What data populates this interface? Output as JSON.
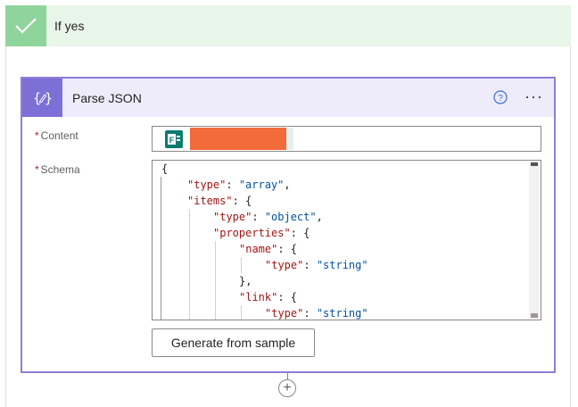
{
  "condition_branch": {
    "label": "If yes"
  },
  "action_card": {
    "title": "Parse JSON",
    "more_label": "···"
  },
  "content_field": {
    "label": "Content",
    "required_mark": "*"
  },
  "schema_field": {
    "label": "Schema",
    "required_mark": "*",
    "code_lines": [
      {
        "indent": 0,
        "parts": [
          [
            "p",
            "{"
          ]
        ]
      },
      {
        "indent": 1,
        "parts": [
          [
            "k",
            "\"type\""
          ],
          [
            "p",
            ": "
          ],
          [
            "s",
            "\"array\""
          ],
          [
            "p",
            ","
          ]
        ]
      },
      {
        "indent": 1,
        "parts": [
          [
            "k",
            "\"items\""
          ],
          [
            "p",
            ": {"
          ]
        ]
      },
      {
        "indent": 2,
        "parts": [
          [
            "k",
            "\"type\""
          ],
          [
            "p",
            ": "
          ],
          [
            "s",
            "\"object\""
          ],
          [
            "p",
            ","
          ]
        ]
      },
      {
        "indent": 2,
        "parts": [
          [
            "k",
            "\"properties\""
          ],
          [
            "p",
            ": {"
          ]
        ]
      },
      {
        "indent": 3,
        "parts": [
          [
            "k",
            "\"name\""
          ],
          [
            "p",
            ": {"
          ]
        ]
      },
      {
        "indent": 4,
        "parts": [
          [
            "k",
            "\"type\""
          ],
          [
            "p",
            ": "
          ],
          [
            "s",
            "\"string\""
          ]
        ]
      },
      {
        "indent": 3,
        "parts": [
          [
            "p",
            "},"
          ]
        ]
      },
      {
        "indent": 3,
        "parts": [
          [
            "k",
            "\"link\""
          ],
          [
            "p",
            ": {"
          ]
        ]
      },
      {
        "indent": 4,
        "parts": [
          [
            "k",
            "\"type\""
          ],
          [
            "p",
            ": "
          ],
          [
            "s",
            "\"string\""
          ]
        ]
      }
    ]
  },
  "generate_button": {
    "label": "Generate from sample"
  },
  "add_step": {
    "label": "+"
  },
  "colors": {
    "branch_bg": "#e8f5e9",
    "branch_accent": "#8fd49a",
    "card_border": "#8a7fd6",
    "card_icon_bg": "#7e6fd7",
    "help_icon": "#3a6dd8",
    "redaction": "#f26b3a"
  },
  "icons": {
    "branch": "check-icon",
    "action": "braces-pencil-icon",
    "help": "help-circle-icon",
    "content_token": "forms-icon"
  }
}
